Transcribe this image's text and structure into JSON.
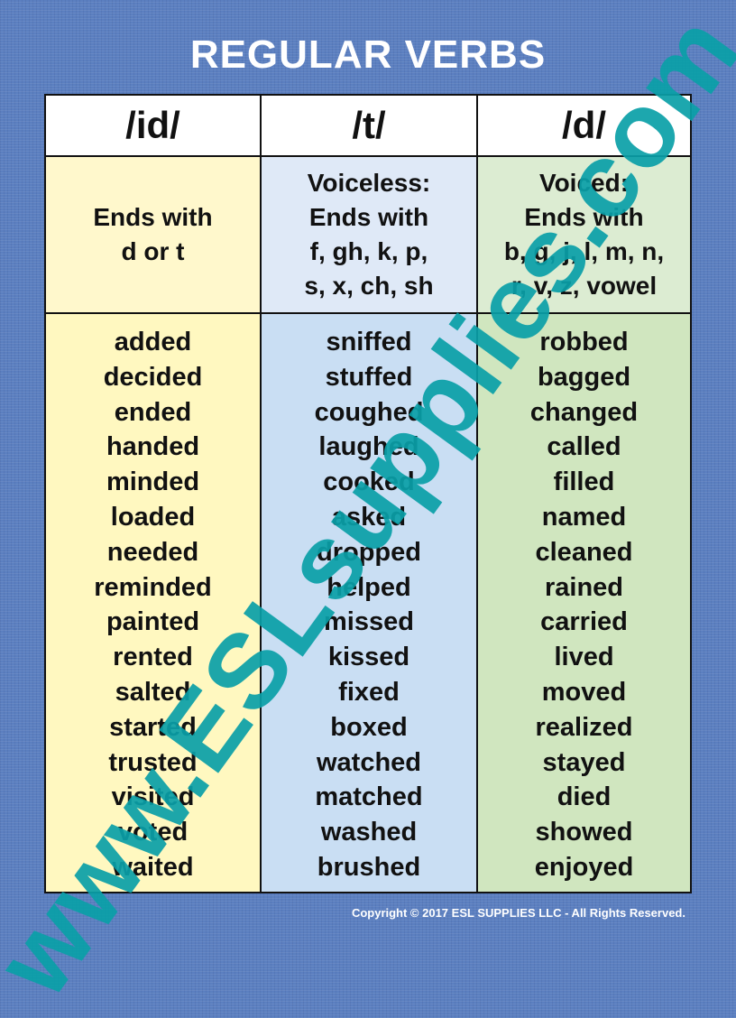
{
  "title": "REGULAR VERBS",
  "columns": [
    {
      "header": "/id/",
      "rule_lines": [
        "Ends with",
        "d or t"
      ],
      "words": [
        "added",
        "decided",
        "ended",
        "handed",
        "minded",
        "loaded",
        "needed",
        "reminded",
        "painted",
        "rented",
        "salted",
        "started",
        "trusted",
        "visited",
        "voted",
        "waited"
      ]
    },
    {
      "header": "/t/",
      "rule_lines": [
        "Voiceless:",
        "Ends with",
        "f, gh, k, p,",
        "s, x, ch, sh"
      ],
      "words": [
        "sniffed",
        "stuffed",
        "coughed",
        "laughed",
        "cooked",
        "asked",
        "dropped",
        "helped",
        "missed",
        "kissed",
        "fixed",
        "boxed",
        "watched",
        "matched",
        "washed",
        "brushed"
      ]
    },
    {
      "header": "/d/",
      "rule_lines": [
        "Voiced:",
        "Ends with",
        "b, g, j, l, m, n,",
        "r, v, z, vowel"
      ],
      "words": [
        "robbed",
        "bagged",
        "changed",
        "called",
        "filled",
        "named",
        "cleaned",
        "rained",
        "carried",
        "lived",
        "moved",
        "realized",
        "stayed",
        "died",
        "showed",
        "enjoyed"
      ]
    }
  ],
  "watermark": "www.ESLsupplies.com",
  "copyright": "Copyright © 2017 ESL SUPPLIES LLC -  All Rights Reserved.",
  "colors": {
    "background": "#5b7fc0",
    "id_column": "#fff8c0",
    "t_column": "#c9def3",
    "d_column": "#d0e6bf",
    "watermark": "#0aa0a8"
  }
}
